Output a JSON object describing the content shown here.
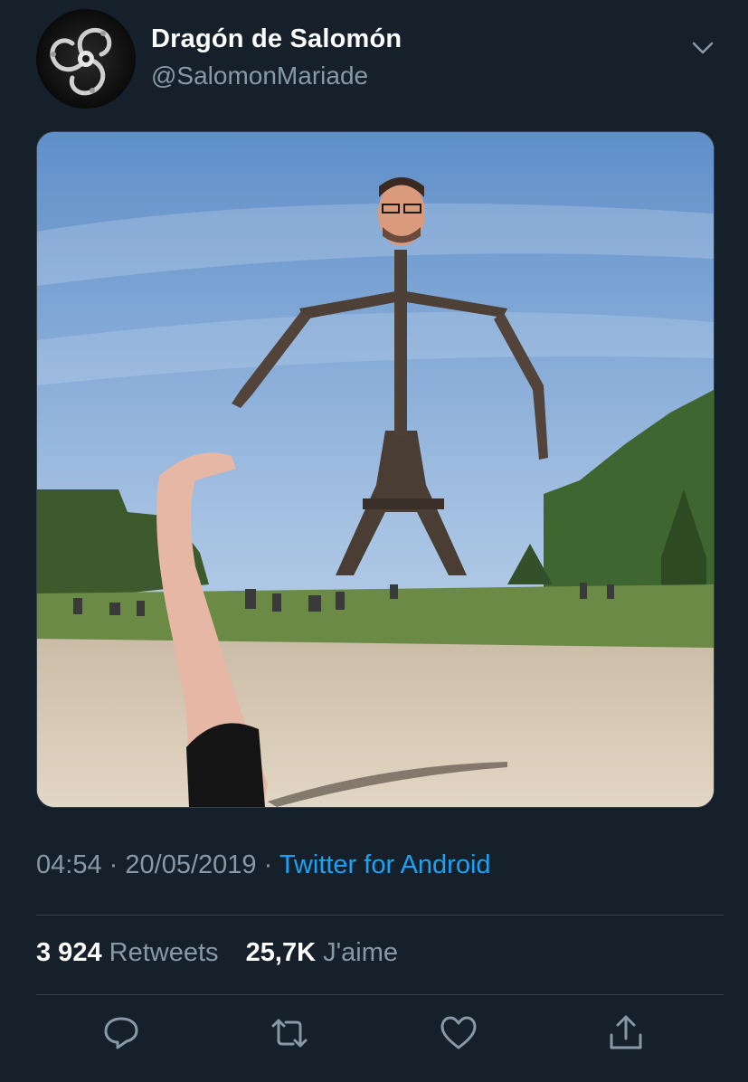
{
  "tweet": {
    "display_name": "Dragón de Salomón",
    "handle": "@SalomonMariade",
    "time": "04:54",
    "separator": "·",
    "date": "20/05/2019",
    "source": "Twitter for Android"
  },
  "stats": {
    "retweets_count": "3 924",
    "retweets_label": "Retweets",
    "likes_count": "25,7K",
    "likes_label": "J'aime"
  },
  "icons": {
    "menu": "chevron-down-icon",
    "reply": "reply-icon",
    "retweet": "retweet-icon",
    "like": "heart-icon",
    "share": "share-icon"
  },
  "colors": {
    "background": "#15202b",
    "secondary_text": "#8899a6",
    "link": "#1da1f2",
    "divider": "#38444d"
  }
}
